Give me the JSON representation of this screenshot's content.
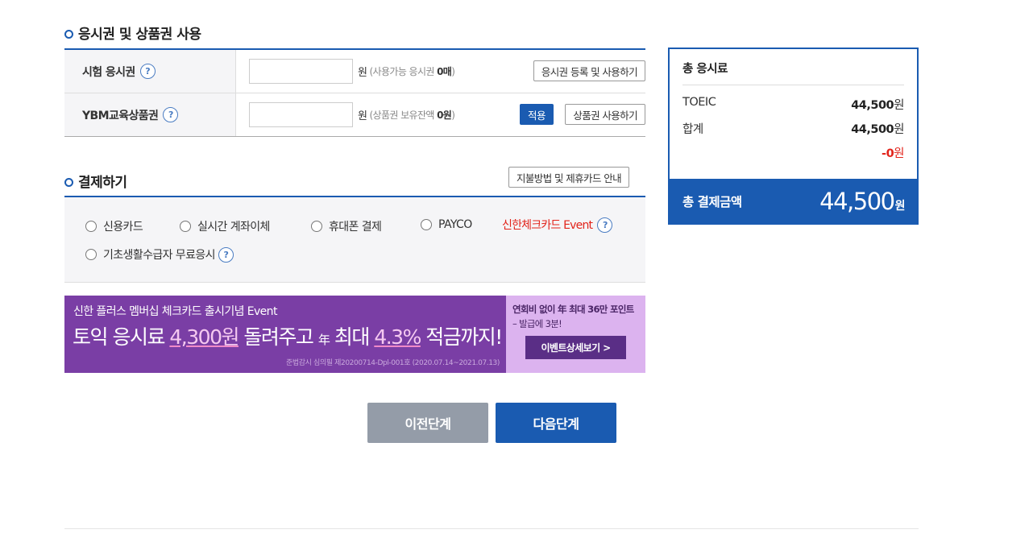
{
  "voucher_section": {
    "title": "응시권 및 상품권 사용",
    "rows": [
      {
        "label": "시험 응시권",
        "unit": "원",
        "hint_prefix": "(사용가능 응시권 ",
        "hint_value": "0매",
        "hint_suffix": ")",
        "button": "응시권 등록 및 사용하기"
      },
      {
        "label": "YBM교육상품권",
        "unit": "원",
        "hint_prefix": "(상품권 보유잔액 ",
        "hint_value": "0원",
        "hint_suffix": ")",
        "apply_button": "적용",
        "button": "상품권 사용하기"
      }
    ]
  },
  "payment_section": {
    "title": "결제하기",
    "guide_button": "지불방법 및 제휴카드 안내",
    "methods": [
      "신용카드",
      "실시간 계좌이체",
      "휴대폰 결제",
      "PAYCO"
    ],
    "event_link": "신한체크카드 Event",
    "free_option": "기초생활수급자 무료응시"
  },
  "banner": {
    "line1": "신한 플러스 멤버십 체크카드 출시기념 Event",
    "line2_a": "토익 응시료 ",
    "line2_amount": "4,300원",
    "line2_b": " 돌려주고 ",
    "line2_year": "年",
    "line2_c": " 최대 ",
    "line2_rate": "4.3%",
    "line2_d": " 적금까지!",
    "legal": "준법감시 심의필 제20200714-Dpl-001호 (2020.07.14~2021.07.13)",
    "right_line1": "연회비 없이 年 최대 36만 포인트",
    "right_line2": "– 발급에 3분!",
    "detail_button": "이벤트상세보기 >"
  },
  "nav": {
    "prev": "이전단계",
    "next": "다음단계"
  },
  "summary": {
    "title": "총 응시료",
    "rows": [
      {
        "label": "TOEIC",
        "amount": "44,500",
        "unit": "원"
      },
      {
        "label": "합계",
        "amount": "44,500",
        "unit": "원"
      }
    ],
    "discount": "-0",
    "discount_unit": "원",
    "total_label": "총 결제금액",
    "total_amount": "44,500",
    "total_unit": "원"
  },
  "colors": {
    "primary": "#1a5bb1",
    "accent_red": "#e2231a",
    "banner_purple": "#7a3ea5",
    "banner_pink": "#dcb3ef",
    "prev_gray": "#949ca8"
  }
}
